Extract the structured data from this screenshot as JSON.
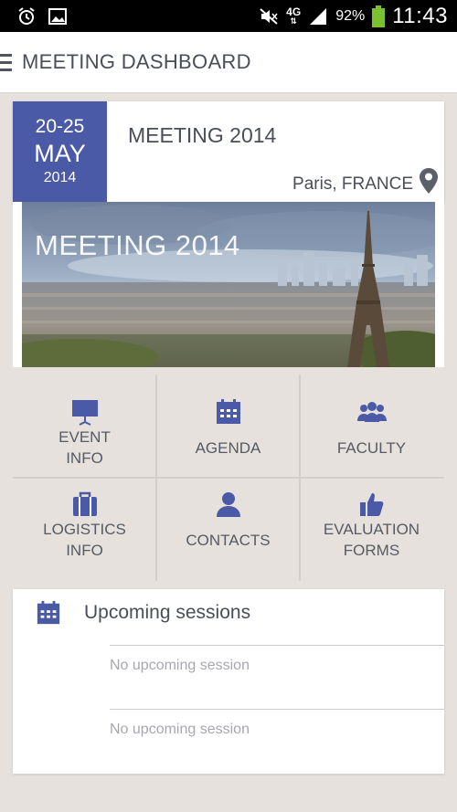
{
  "status_bar": {
    "network": "4G",
    "battery": "92%",
    "time": "11:43"
  },
  "app_bar": {
    "title": "MEETING DASHBOARD"
  },
  "meeting": {
    "date_range": "20-25",
    "month": "MAY",
    "year": "2014",
    "title": "MEETING 2014",
    "location": "Paris, FRANCE",
    "banner_text": "MEETING 2014"
  },
  "menu": [
    {
      "label": "EVENT\nINFO",
      "icon": "projector-screen-icon"
    },
    {
      "label": "AGENDA",
      "icon": "calendar-icon"
    },
    {
      "label": "FACULTY",
      "icon": "group-icon"
    },
    {
      "label": "LOGISTICS\nINFO",
      "icon": "suitcase-icon"
    },
    {
      "label": "CONTACTS",
      "icon": "person-icon"
    },
    {
      "label": "EVALUATION\nFORMS",
      "icon": "thumbs-up-icon"
    }
  ],
  "sessions": {
    "title": "Upcoming sessions",
    "items": [
      "No upcoming session",
      "No upcoming session"
    ]
  },
  "colors": {
    "accent": "#4b5aa6",
    "background": "#e6e1dc",
    "text": "#4a4e58"
  }
}
